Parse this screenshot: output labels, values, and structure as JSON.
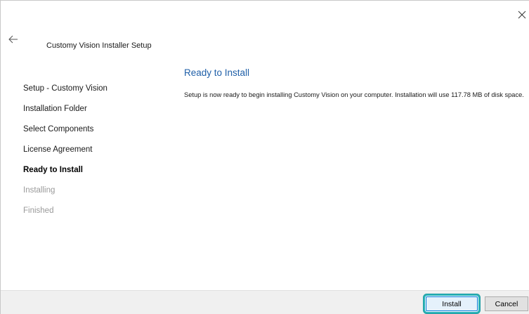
{
  "window": {
    "title": "Customy Vision Installer Setup"
  },
  "icons": {
    "back": "arrow-left-icon",
    "close": "close-icon"
  },
  "steps": [
    {
      "label": "Setup - Customy Vision",
      "state": "done"
    },
    {
      "label": "Installation Folder",
      "state": "done"
    },
    {
      "label": "Select Components",
      "state": "done"
    },
    {
      "label": "License Agreement",
      "state": "done"
    },
    {
      "label": "Ready to Install",
      "state": "active"
    },
    {
      "label": "Installing",
      "state": "pending"
    },
    {
      "label": "Finished",
      "state": "pending"
    }
  ],
  "content": {
    "heading": "Ready to Install",
    "description": "Setup is now ready to begin installing Customy Vision on your computer. Installation will use 117.78 MB of disk space."
  },
  "buttons": {
    "install_label": "Install",
    "cancel_label": "Cancel"
  },
  "colors": {
    "heading": "#1f5fa8",
    "focus_ring": "#2bb3b8",
    "footer_bg": "#f0f0f0"
  }
}
